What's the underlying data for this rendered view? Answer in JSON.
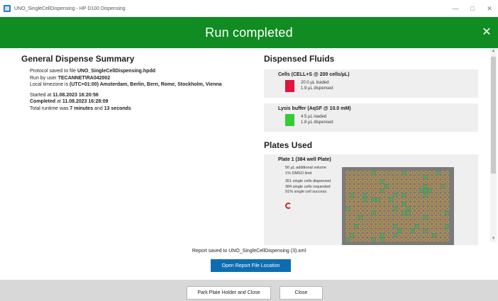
{
  "window": {
    "title": "UNO_SingleCellDispensing - HP D100 Dispensing"
  },
  "banner": {
    "title": "Run completed",
    "close_glyph": "✕"
  },
  "summary": {
    "heading": "General Dispense Summary",
    "line1_prefix": "Protocol saved to file ",
    "line1_file": "UNO_SingleCellDispensing.hpdd",
    "line2_prefix": "Run by user ",
    "line2_user": "TECANNET\\RA042002",
    "line3_prefix": "Local timezone is ",
    "line3_tz": "(UTC+01:00) Amsterdam, Berlin, Bern, Rome, Stockholm, Vienna",
    "started_prefix": "Started at ",
    "started_value": "11.08.2023 16:20:56",
    "completed_prefix": "Completed",
    "completed_mid": " at ",
    "completed_value": "11.08.2023 16:28:09",
    "runtime_prefix": "Total runtime was ",
    "runtime_minutes": "7 minutes",
    "runtime_and": " and ",
    "runtime_seconds": "13 seconds"
  },
  "fluids": {
    "heading": "Dispensed Fluids",
    "items": [
      {
        "name": "Cells (CELL+S @ 200 cells/µL)",
        "loaded": "20.0 µL loaded",
        "dispensed": "1.9 µL dispensed",
        "color": "#e0143c"
      },
      {
        "name": "Lysis buffer (AqSF @ 10.0 mM)",
        "loaded": "4.5 µL loaded",
        "dispensed": "1.8 µL dispensed",
        "color": "#33cc33"
      }
    ]
  },
  "plates": {
    "heading": "Plates Used",
    "plate1": {
      "name": "Plate 1 (384 well Plate)",
      "additional_volume": "50 µL additional volume",
      "dmso_limit": "1% DMSO limit",
      "dispensed": "351 single cells dispensed",
      "requested": "384 single cells requested",
      "success": "91% single cell success",
      "well_colors": {
        "filled": "#e8a020",
        "empty": "#33cc33",
        "grid": "#7a7a7a"
      }
    }
  },
  "report": {
    "saved_text": "Report saved to UNO_SingleCellDispensing (3).xml",
    "open_button": "Open Report File Location"
  },
  "footer": {
    "park_button": "Park Plate Holder and Close",
    "close_button": "Close"
  }
}
